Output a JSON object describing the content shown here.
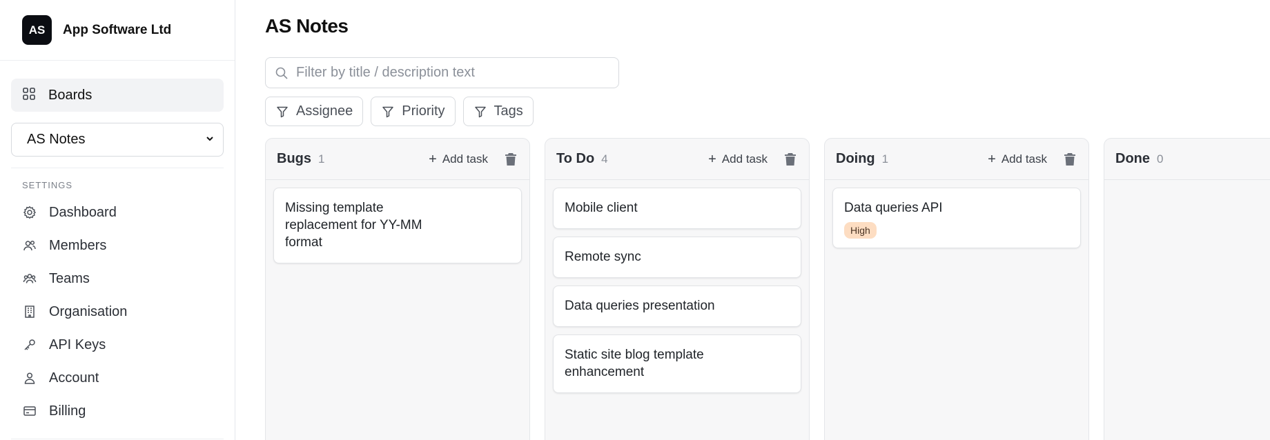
{
  "org": {
    "initials": "AS",
    "name": "App Software Ltd"
  },
  "nav": {
    "boards_label": "Boards"
  },
  "board_select": {
    "value": "AS Notes"
  },
  "settings": {
    "title": "SETTINGS",
    "items": [
      {
        "label": "Dashboard",
        "icon": "gear-icon"
      },
      {
        "label": "Members",
        "icon": "members-icon"
      },
      {
        "label": "Teams",
        "icon": "teams-icon"
      },
      {
        "label": "Organisation",
        "icon": "building-icon"
      },
      {
        "label": "API Keys",
        "icon": "key-icon"
      },
      {
        "label": "Account",
        "icon": "user-icon"
      },
      {
        "label": "Billing",
        "icon": "credit-card-icon"
      }
    ]
  },
  "page": {
    "title": "AS Notes"
  },
  "search": {
    "placeholder": "Filter by title / description text",
    "value": ""
  },
  "filters": [
    {
      "label": "Assignee"
    },
    {
      "label": "Priority"
    },
    {
      "label": "Tags"
    }
  ],
  "add_task_label": "Add task",
  "columns": [
    {
      "title": "Bugs",
      "count": "1",
      "cards": [
        {
          "title": "Missing template replacement for YY-MM format"
        }
      ]
    },
    {
      "title": "To Do",
      "count": "4",
      "cards": [
        {
          "title": "Mobile client"
        },
        {
          "title": "Remote sync"
        },
        {
          "title": "Data queries presentation"
        },
        {
          "title": "Static site blog template enhancement"
        }
      ]
    },
    {
      "title": "Doing",
      "count": "1",
      "cards": [
        {
          "title": "Data queries API",
          "badge": "High"
        }
      ]
    },
    {
      "title": "Done",
      "count": "0",
      "cards": []
    }
  ],
  "colors": {
    "badge_high": "#fdddc2",
    "org_avatar": "#0b0d12"
  }
}
